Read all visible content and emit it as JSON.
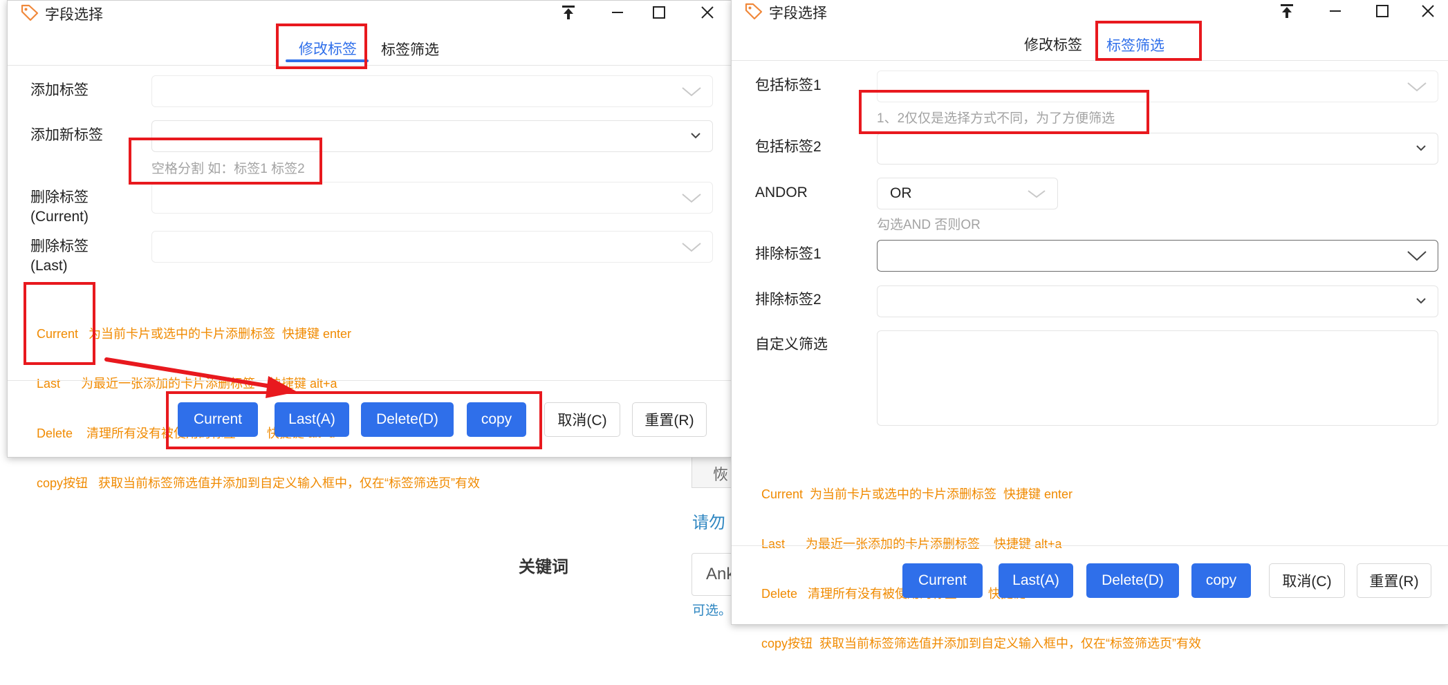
{
  "background": {
    "keyword_label": "关键词",
    "link_text": "请勿",
    "input_text": "Ank",
    "small_text": "可选。",
    "box_text": "恢"
  },
  "window_left": {
    "title": "字段选择",
    "tabs": [
      {
        "label": "修改标签",
        "active": true
      },
      {
        "label": "标签筛选",
        "active": false
      }
    ],
    "rows": {
      "add_tag": {
        "label": "添加标签"
      },
      "add_new_tag": {
        "label": "添加新标签",
        "hint": "空格分割 如：标签1 标签2"
      },
      "delete_current": {
        "label_line1": "删除标签",
        "label_line2": "(Current)"
      },
      "delete_last": {
        "label_line1": "删除标签",
        "label_line2": "(Last)"
      }
    },
    "help_lines": [
      "Current   为当前卡片或选中的卡片添删标签  快捷键 enter",
      "Last      为最近一张添加的卡片添删标签    快捷键 alt+a",
      "Delete    清理所有没有被使用的标签         快捷键 alt+d",
      "copy按钮   获取当前标签筛选值并添加到自定义输入框中，仅在“标签筛选页”有效"
    ],
    "buttons": {
      "current": "Current",
      "last": "Last(A)",
      "delete": "Delete(D)",
      "copy": "copy",
      "cancel": "取消(C)",
      "reset": "重置(R)"
    }
  },
  "window_right": {
    "title": "字段选择",
    "tabs": [
      {
        "label": "修改标签",
        "active": false
      },
      {
        "label": "标签筛选",
        "active": true
      }
    ],
    "rows": {
      "include1": {
        "label": "包括标签1",
        "hint": "1、2仅仅是选择方式不同，为了方便筛选"
      },
      "include2": {
        "label": "包括标签2"
      },
      "andor": {
        "label": "ANDOR",
        "value": "OR",
        "hint": "勾选AND 否则OR"
      },
      "exclude1": {
        "label": "排除标签1"
      },
      "exclude2": {
        "label": "排除标签2"
      },
      "custom": {
        "label": "自定义筛选"
      }
    },
    "help_lines": [
      "Current  为当前卡片或选中的卡片添删标签  快捷键 enter",
      "Last      为最近一张添加的卡片添删标签    快捷键 alt+a",
      "Delete   清理所有没有被使用的标签         快捷键 alt+d",
      "copy按钮  获取当前标签筛选值并添加到自定义输入框中，仅在“标签筛选页”有效"
    ],
    "buttons": {
      "current": "Current",
      "last": "Last(A)",
      "delete": "Delete(D)",
      "copy": "copy",
      "cancel": "取消(C)",
      "reset": "重置(R)"
    }
  },
  "colors": {
    "accent": "#2f6fea",
    "help_text": "#f08a00",
    "annotation": "#e8191e"
  }
}
